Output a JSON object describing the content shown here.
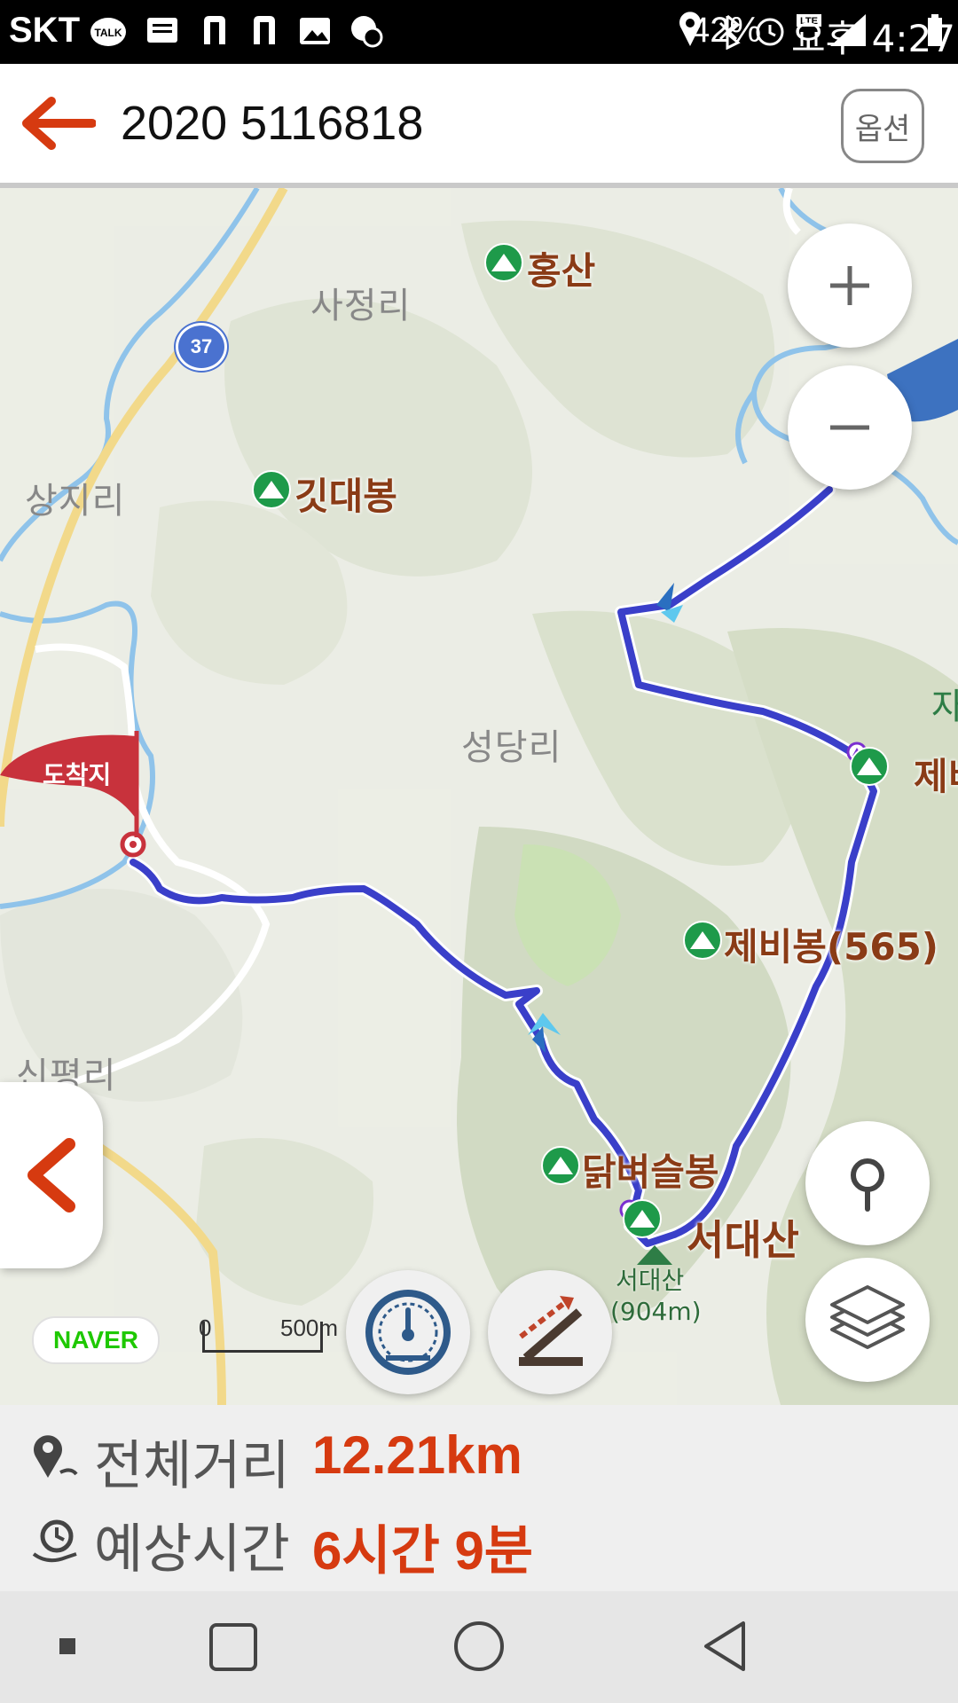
{
  "status_bar": {
    "carrier": "SKT",
    "battery": "42%",
    "time": "오후 4:27",
    "icons": [
      "kakaotalk-icon",
      "message-icon",
      "naver-n-icon",
      "naver-n-icon",
      "gallery-icon",
      "location-time-icon",
      "location-icon",
      "bluetooth-icon",
      "alarm-icon",
      "lte-icon",
      "signal-icon",
      "battery-icon"
    ]
  },
  "header": {
    "title": "2020 5116818",
    "options_label": "옵션",
    "accent_color": "#d63a10"
  },
  "map": {
    "places": {
      "sajeong": "사정리",
      "sangji": "상지리",
      "seongdang": "성당리",
      "sinpyeong": "신평리",
      "ja": "자"
    },
    "peaks": {
      "hongsan": "홍산",
      "gitdaebong": "깃대봉",
      "jebibong_565": "제비봉(565)",
      "jebi_partial": "제비",
      "dakbyeoseulbong": "닭벼슬봉",
      "seodaesan": "서대산",
      "seodaesan_small": "서대산",
      "seodaesan_elev": "(904m)"
    },
    "road_number": "37",
    "arrival_flag": "도착지",
    "scale_zero": "0",
    "scale_distance": "500m",
    "logo": "NAVER",
    "route_color": "#3a3fc9",
    "peak_icon_color": "#1e9a4a"
  },
  "summary": {
    "distance_label": "전체거리",
    "distance_value": "12.21km",
    "time_label": "예상시간",
    "time_value": "6시간 9분"
  }
}
